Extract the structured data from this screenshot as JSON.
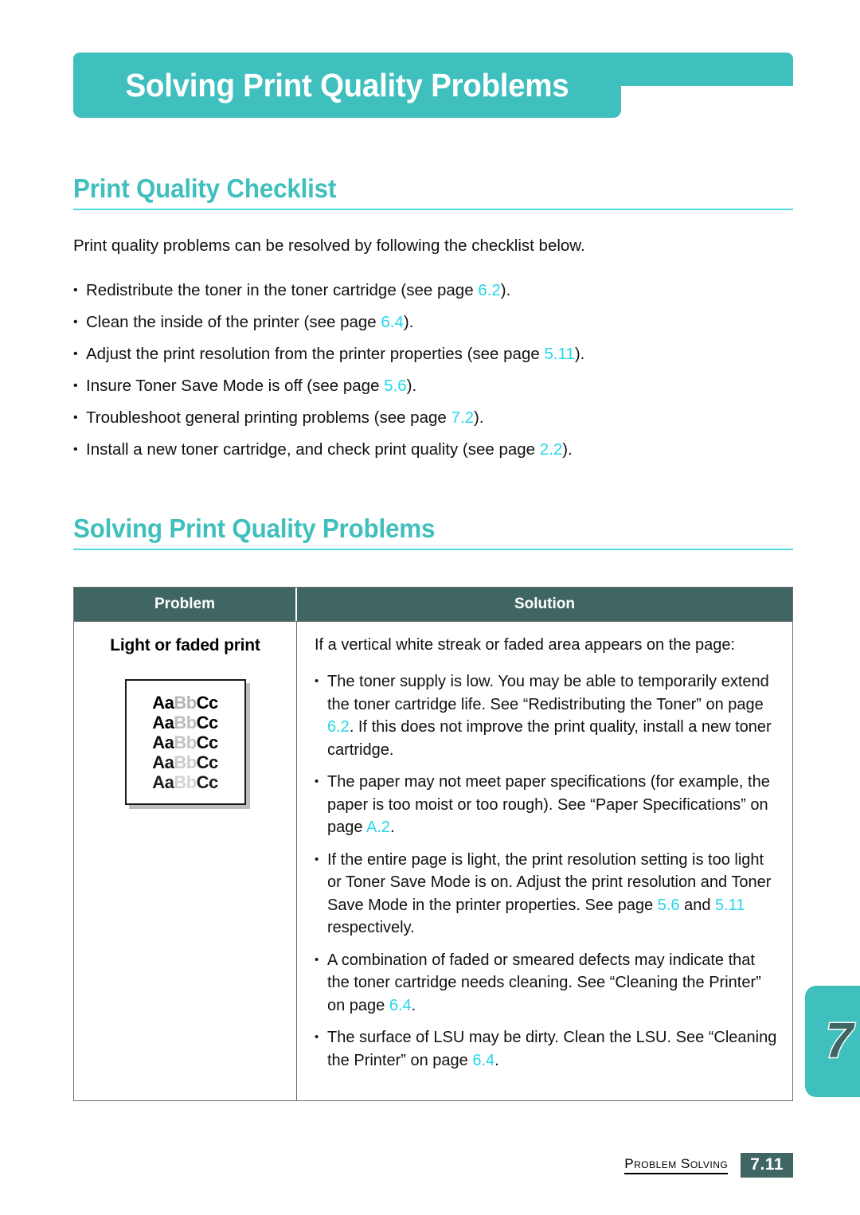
{
  "banner": {
    "title": "Solving Print Quality Problems"
  },
  "sections": [
    {
      "heading": "Print Quality Checklist"
    },
    {
      "heading": "Solving Print Quality Problems"
    }
  ],
  "intro": "Print quality problems can be resolved by following the checklist below.",
  "bullet_glyph": "•",
  "checklist": [
    {
      "pre": "Redistribute the toner in the toner cartridge (see page ",
      "ref": "6.2",
      "post": ")."
    },
    {
      "pre": "Clean the inside of the printer (see page ",
      "ref": "6.4",
      "post": ")."
    },
    {
      "pre": "Adjust the print resolution from the printer properties (see page ",
      "ref": "5.11",
      "post": ")."
    },
    {
      "pre": "Insure Toner Save Mode is off (see page ",
      "ref": "5.6",
      "post": ")."
    },
    {
      "pre": "Troubleshoot general printing problems (see page ",
      "ref": "7.2",
      "post": ")."
    },
    {
      "pre": "Install a new toner cartridge, and check print quality (see page ",
      "ref": "2.2",
      "post": ")."
    }
  ],
  "table": {
    "headers": {
      "problem": "Problem",
      "solution": "Solution"
    },
    "row": {
      "problem_label": "Light or faded print",
      "sample": {
        "lines": [
          {
            "a": "Aa",
            "b": "Bb",
            "c": "Cc"
          },
          {
            "a": "Aa",
            "b": "Bb",
            "c": "Cc"
          },
          {
            "a": "Aa",
            "b": "Bb",
            "c": "Cc"
          },
          {
            "a": "Aa",
            "b": "Bb",
            "c": "Cc"
          },
          {
            "a": "Aa",
            "b": "Bb",
            "c": "Cc"
          }
        ]
      },
      "solution_intro": "If a vertical white streak or faded area appears on the page:",
      "solution_bullets": [
        {
          "parts": [
            {
              "t": "The toner supply is low. You may be able to temporarily extend the toner cartridge life. See “Redistributing the Toner” on page ",
              "ref": false
            },
            {
              "t": "6.2",
              "ref": true
            },
            {
              "t": ". If this does not improve the print quality, install a new toner cartridge.",
              "ref": false
            }
          ]
        },
        {
          "parts": [
            {
              "t": "The paper may not meet paper specifications (for example, the paper is too moist or too rough). See “Paper Specifications” on page ",
              "ref": false
            },
            {
              "t": "A.2",
              "ref": true
            },
            {
              "t": ".",
              "ref": false
            }
          ]
        },
        {
          "parts": [
            {
              "t": "If the entire page is light, the print resolution setting is too light or Toner Save Mode is on. Adjust the print resolution and Toner Save Mode in the printer properties. See page ",
              "ref": false
            },
            {
              "t": "5.6",
              "ref": true
            },
            {
              "t": " and ",
              "ref": false
            },
            {
              "t": "5.11",
              "ref": true
            },
            {
              "t": " respectively.",
              "ref": false
            }
          ]
        },
        {
          "parts": [
            {
              "t": "A combination of faded or smeared defects may indicate that the toner cartridge needs cleaning. See “Cleaning the Printer” on page ",
              "ref": false
            },
            {
              "t": "6.4",
              "ref": true
            },
            {
              "t": ".",
              "ref": false
            }
          ]
        },
        {
          "parts": [
            {
              "t": "The surface of LSU may be dirty. Clean the LSU. See “Cleaning the Printer” on page ",
              "ref": false
            },
            {
              "t": "6.4",
              "ref": true
            },
            {
              "t": ".",
              "ref": false
            }
          ]
        }
      ]
    }
  },
  "chapter_tab": {
    "number": "7"
  },
  "footer": {
    "label": "Problem Solving",
    "page": "7.11"
  },
  "colors": {
    "teal": "#3fbfbd",
    "dark_teal": "#406663",
    "reference_cyan": "#25d7e8",
    "rule_cyan": "#4fd8dd"
  }
}
